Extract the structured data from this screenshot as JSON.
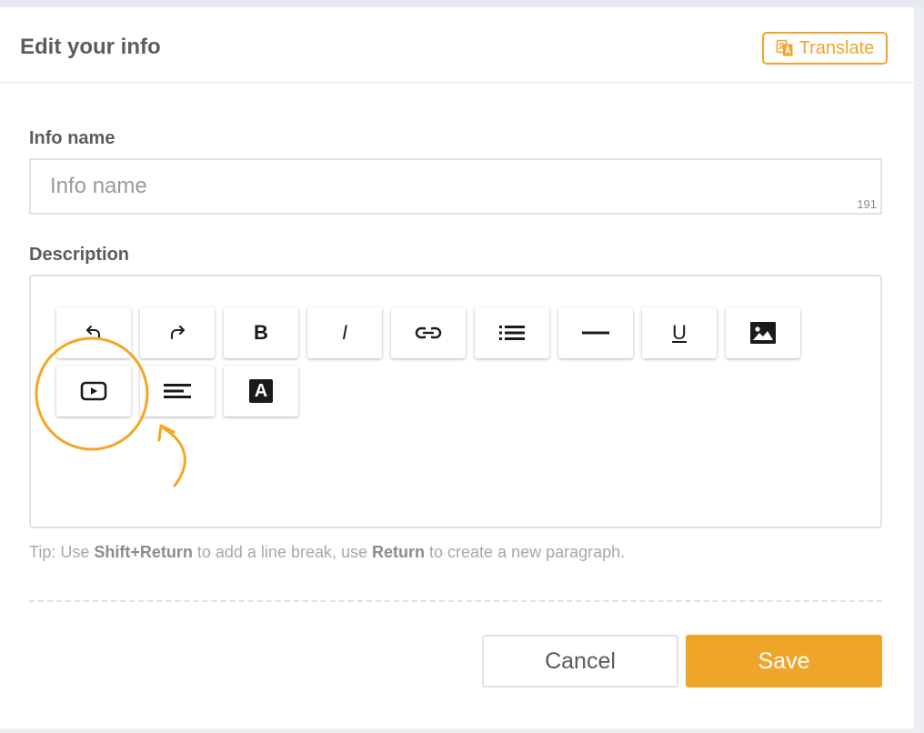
{
  "header": {
    "title": "Edit your info",
    "translate_label": "Translate"
  },
  "form": {
    "name_label": "Info name",
    "name_placeholder": "Info name",
    "name_value": "",
    "name_char_count": "191",
    "description_label": "Description",
    "toolbar": [
      {
        "name": "undo",
        "icon": "undo-icon"
      },
      {
        "name": "redo",
        "icon": "redo-icon"
      },
      {
        "name": "bold",
        "icon": "bold-icon",
        "text": "B"
      },
      {
        "name": "italic",
        "icon": "italic-icon",
        "text": "I"
      },
      {
        "name": "link",
        "icon": "link-icon"
      },
      {
        "name": "bulleted-list",
        "icon": "bulleted-list-icon"
      },
      {
        "name": "horizontal-rule",
        "icon": "horizontal-rule-icon"
      },
      {
        "name": "underline",
        "icon": "underline-icon",
        "text": "U"
      },
      {
        "name": "image",
        "icon": "image-icon"
      },
      {
        "name": "video",
        "icon": "video-play-icon"
      },
      {
        "name": "align",
        "icon": "align-left-icon"
      },
      {
        "name": "text-style",
        "icon": "text-style-icon",
        "text": "A"
      }
    ],
    "tip": {
      "prefix": "Tip: Use ",
      "key1": "Shift+Return",
      "middle": " to add a line break, use ",
      "key2": "Return",
      "suffix": " to create a new paragraph."
    }
  },
  "actions": {
    "cancel_label": "Cancel",
    "save_label": "Save"
  },
  "colors": {
    "accent": "#efa52a",
    "annotation": "#f5a623",
    "text": "#5c5c5c",
    "border": "#e2e2e2"
  }
}
